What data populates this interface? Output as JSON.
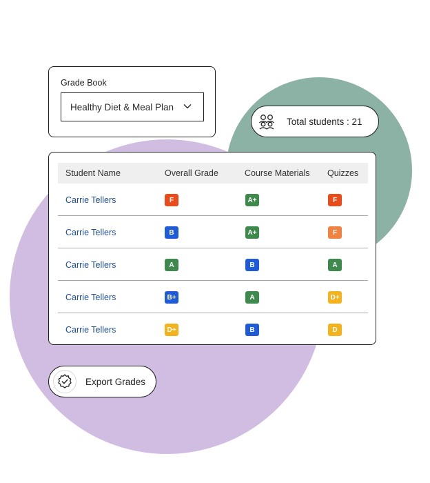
{
  "gradebook": {
    "label": "Grade Book",
    "selected_course": "Healthy Diet & Meal Plan"
  },
  "total_students": {
    "text": "Total students : 21",
    "icon": "users-icon"
  },
  "table": {
    "headers": [
      "Student Name",
      "Overall Grade",
      "Course Materials",
      "Quizzes"
    ],
    "rows": [
      {
        "name": "Carrie Tellers",
        "overall": "F",
        "materials": "A+",
        "quizzes": "F"
      },
      {
        "name": "Carrie Tellers",
        "overall": "B",
        "materials": "A+",
        "quizzes": "F"
      },
      {
        "name": "Carrie Tellers",
        "overall": "A",
        "materials": "B",
        "quizzes": "A"
      },
      {
        "name": "Carrie Tellers",
        "overall": "B+",
        "materials": "A",
        "quizzes": "D+"
      },
      {
        "name": "Carrie Tellers",
        "overall": "D+",
        "materials": "B",
        "quizzes": "D"
      }
    ],
    "badge_colors": {
      "row0": [
        "#ea4b1a",
        "#3d8a4c",
        "#ea4b1a"
      ],
      "row1": [
        "#1f5bd8",
        "#3d8a4c",
        "#f08242"
      ],
      "row2": [
        "#3d8a4c",
        "#1f5bd8",
        "#3d8a4c"
      ],
      "row3": [
        "#1f5bd8",
        "#3d8a4c",
        "#f4b21d"
      ],
      "row4": [
        "#f4b21d",
        "#1f5bd8",
        "#f4b21d"
      ]
    }
  },
  "export": {
    "label": "Export Grades",
    "icon": "verified-badge-icon"
  },
  "colors": {
    "green_circle": "#8bb2a5",
    "purple_circle": "#d2bde2",
    "link": "#1d4d9e"
  }
}
